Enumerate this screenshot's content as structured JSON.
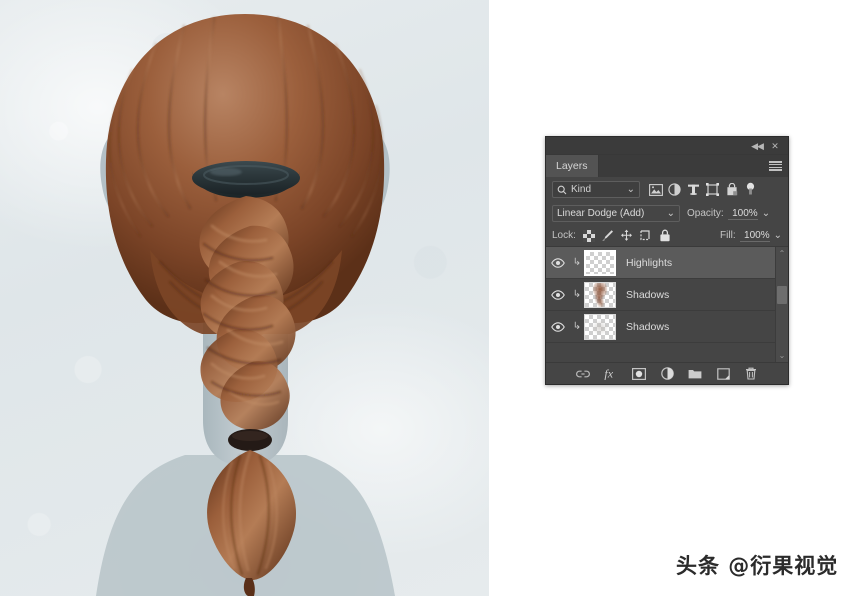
{
  "artwork": {
    "title": "braided-hairstyle-illustration",
    "description": "Digital painting of the back of a head with a long french braid",
    "colors": {
      "background": "#e3e8ea",
      "skin_silhouette": "#b8c4c9",
      "hair_light": "#b07a55",
      "hair_mid": "#8a4f32",
      "hair_dark": "#5d3019",
      "hair_tie_top": "#2e3a3e",
      "hair_tie_bottom": "#241a16"
    }
  },
  "watermark": {
    "text": "头条 @衍果视觉"
  },
  "panel": {
    "titlebar": {
      "collapse_label": "◀◀",
      "close_label": "✕"
    },
    "tab": {
      "label": "Layers",
      "menu_label": "panel-menu"
    },
    "filter": {
      "kind_label": "Kind",
      "search_icon": "search-icon",
      "chevron": "⌄",
      "icons": [
        {
          "name": "filter-pixel-icon",
          "glyph": "image"
        },
        {
          "name": "filter-adjustment-icon",
          "glyph": "half-circle"
        },
        {
          "name": "filter-type-icon",
          "glyph": "T"
        },
        {
          "name": "filter-shape-icon",
          "glyph": "frame"
        },
        {
          "name": "filter-smart-object-icon",
          "glyph": "smart"
        }
      ],
      "toggle_name": "filter-enable-toggle"
    },
    "blend": {
      "mode": "Linear Dodge (Add)",
      "chevron": "⌄",
      "opacity_label": "Opacity:",
      "opacity_value": "100%",
      "opacity_chevron": "⌄"
    },
    "lock": {
      "label": "Lock:",
      "icons": [
        {
          "name": "lock-transparency-icon",
          "glyph": "checker"
        },
        {
          "name": "lock-image-pixels-icon",
          "glyph": "brush"
        },
        {
          "name": "lock-position-icon",
          "glyph": "move"
        },
        {
          "name": "lock-artboard-icon",
          "glyph": "artboard"
        },
        {
          "name": "lock-all-icon",
          "glyph": "padlock"
        }
      ],
      "fill_label": "Fill:",
      "fill_value": "100%",
      "fill_chevron": "⌄"
    },
    "layers": [
      {
        "name": "Highlights",
        "visible": true,
        "selected": true,
        "clipped": true,
        "thumbnail": "empty",
        "clip_glyph": "↳"
      },
      {
        "name": "Shadows",
        "visible": true,
        "selected": false,
        "clipped": true,
        "thumbnail": "braid",
        "clip_glyph": "↳"
      },
      {
        "name": "Shadows",
        "visible": true,
        "selected": false,
        "clipped": true,
        "thumbnail": "faint",
        "clip_glyph": "↳"
      }
    ],
    "scrollbar": {
      "up_glyph": "⌃",
      "down_glyph": "⌄"
    },
    "bottom_bar": [
      {
        "name": "link-layers-button",
        "glyph": "link"
      },
      {
        "name": "layer-style-fx-button",
        "glyph": "fx"
      },
      {
        "name": "add-layer-mask-button",
        "glyph": "mask"
      },
      {
        "name": "new-adjustment-layer-button",
        "glyph": "adjustment"
      },
      {
        "name": "new-group-button",
        "glyph": "folder"
      },
      {
        "name": "new-layer-button",
        "glyph": "newlayer"
      },
      {
        "name": "delete-layer-button",
        "glyph": "trash"
      }
    ]
  }
}
